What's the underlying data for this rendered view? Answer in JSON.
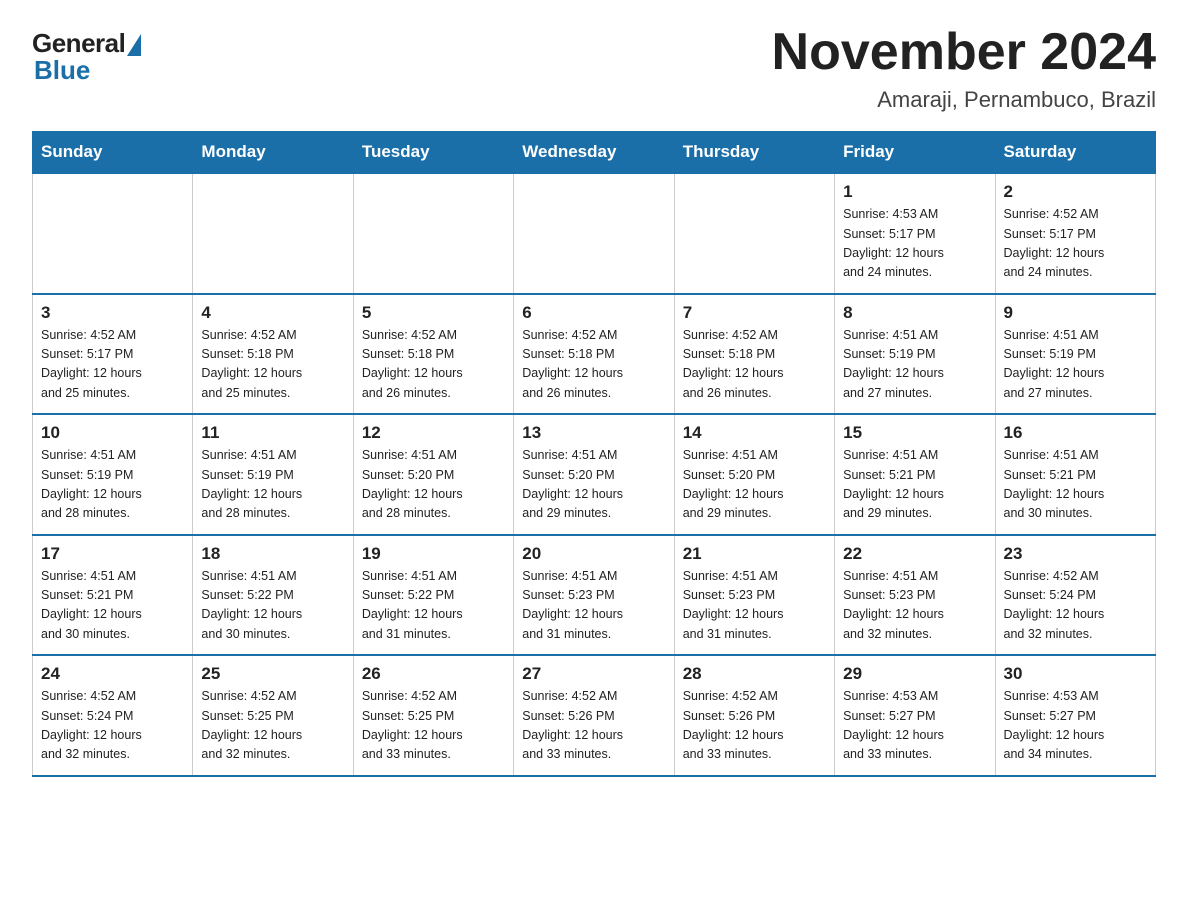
{
  "logo": {
    "general": "General",
    "blue": "Blue"
  },
  "title": "November 2024",
  "subtitle": "Amaraji, Pernambuco, Brazil",
  "days_of_week": [
    "Sunday",
    "Monday",
    "Tuesday",
    "Wednesday",
    "Thursday",
    "Friday",
    "Saturday"
  ],
  "weeks": [
    [
      {
        "day": "",
        "empty": true
      },
      {
        "day": "",
        "empty": true
      },
      {
        "day": "",
        "empty": true
      },
      {
        "day": "",
        "empty": true
      },
      {
        "day": "",
        "empty": true
      },
      {
        "day": "1",
        "sunrise": "4:53 AM",
        "sunset": "5:17 PM",
        "daylight": "12 hours and 24 minutes."
      },
      {
        "day": "2",
        "sunrise": "4:52 AM",
        "sunset": "5:17 PM",
        "daylight": "12 hours and 24 minutes."
      }
    ],
    [
      {
        "day": "3",
        "sunrise": "4:52 AM",
        "sunset": "5:17 PM",
        "daylight": "12 hours and 25 minutes."
      },
      {
        "day": "4",
        "sunrise": "4:52 AM",
        "sunset": "5:18 PM",
        "daylight": "12 hours and 25 minutes."
      },
      {
        "day": "5",
        "sunrise": "4:52 AM",
        "sunset": "5:18 PM",
        "daylight": "12 hours and 26 minutes."
      },
      {
        "day": "6",
        "sunrise": "4:52 AM",
        "sunset": "5:18 PM",
        "daylight": "12 hours and 26 minutes."
      },
      {
        "day": "7",
        "sunrise": "4:52 AM",
        "sunset": "5:18 PM",
        "daylight": "12 hours and 26 minutes."
      },
      {
        "day": "8",
        "sunrise": "4:51 AM",
        "sunset": "5:19 PM",
        "daylight": "12 hours and 27 minutes."
      },
      {
        "day": "9",
        "sunrise": "4:51 AM",
        "sunset": "5:19 PM",
        "daylight": "12 hours and 27 minutes."
      }
    ],
    [
      {
        "day": "10",
        "sunrise": "4:51 AM",
        "sunset": "5:19 PM",
        "daylight": "12 hours and 28 minutes."
      },
      {
        "day": "11",
        "sunrise": "4:51 AM",
        "sunset": "5:19 PM",
        "daylight": "12 hours and 28 minutes."
      },
      {
        "day": "12",
        "sunrise": "4:51 AM",
        "sunset": "5:20 PM",
        "daylight": "12 hours and 28 minutes."
      },
      {
        "day": "13",
        "sunrise": "4:51 AM",
        "sunset": "5:20 PM",
        "daylight": "12 hours and 29 minutes."
      },
      {
        "day": "14",
        "sunrise": "4:51 AM",
        "sunset": "5:20 PM",
        "daylight": "12 hours and 29 minutes."
      },
      {
        "day": "15",
        "sunrise": "4:51 AM",
        "sunset": "5:21 PM",
        "daylight": "12 hours and 29 minutes."
      },
      {
        "day": "16",
        "sunrise": "4:51 AM",
        "sunset": "5:21 PM",
        "daylight": "12 hours and 30 minutes."
      }
    ],
    [
      {
        "day": "17",
        "sunrise": "4:51 AM",
        "sunset": "5:21 PM",
        "daylight": "12 hours and 30 minutes."
      },
      {
        "day": "18",
        "sunrise": "4:51 AM",
        "sunset": "5:22 PM",
        "daylight": "12 hours and 30 minutes."
      },
      {
        "day": "19",
        "sunrise": "4:51 AM",
        "sunset": "5:22 PM",
        "daylight": "12 hours and 31 minutes."
      },
      {
        "day": "20",
        "sunrise": "4:51 AM",
        "sunset": "5:23 PM",
        "daylight": "12 hours and 31 minutes."
      },
      {
        "day": "21",
        "sunrise": "4:51 AM",
        "sunset": "5:23 PM",
        "daylight": "12 hours and 31 minutes."
      },
      {
        "day": "22",
        "sunrise": "4:51 AM",
        "sunset": "5:23 PM",
        "daylight": "12 hours and 32 minutes."
      },
      {
        "day": "23",
        "sunrise": "4:52 AM",
        "sunset": "5:24 PM",
        "daylight": "12 hours and 32 minutes."
      }
    ],
    [
      {
        "day": "24",
        "sunrise": "4:52 AM",
        "sunset": "5:24 PM",
        "daylight": "12 hours and 32 minutes."
      },
      {
        "day": "25",
        "sunrise": "4:52 AM",
        "sunset": "5:25 PM",
        "daylight": "12 hours and 32 minutes."
      },
      {
        "day": "26",
        "sunrise": "4:52 AM",
        "sunset": "5:25 PM",
        "daylight": "12 hours and 33 minutes."
      },
      {
        "day": "27",
        "sunrise": "4:52 AM",
        "sunset": "5:26 PM",
        "daylight": "12 hours and 33 minutes."
      },
      {
        "day": "28",
        "sunrise": "4:52 AM",
        "sunset": "5:26 PM",
        "daylight": "12 hours and 33 minutes."
      },
      {
        "day": "29",
        "sunrise": "4:53 AM",
        "sunset": "5:27 PM",
        "daylight": "12 hours and 33 minutes."
      },
      {
        "day": "30",
        "sunrise": "4:53 AM",
        "sunset": "5:27 PM",
        "daylight": "12 hours and 34 minutes."
      }
    ]
  ],
  "labels": {
    "sunrise": "Sunrise:",
    "sunset": "Sunset:",
    "daylight": "Daylight:"
  }
}
